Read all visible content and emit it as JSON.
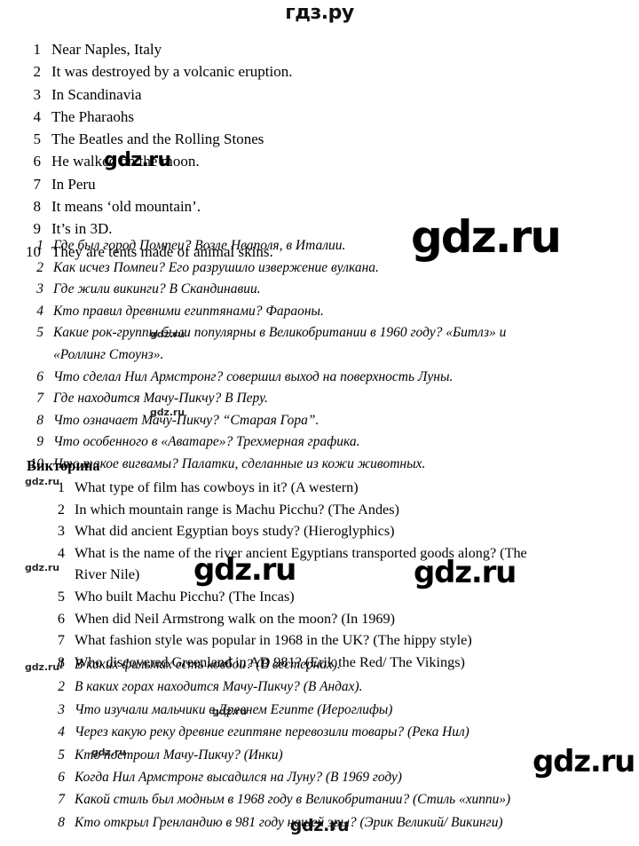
{
  "site": {
    "mark_top": "гдз.ру",
    "mark_bottom": "gdz.ru",
    "watermark_text": "gdz.ru"
  },
  "answers_en": {
    "items": [
      {
        "num": "1",
        "text": "Near Naples, Italy"
      },
      {
        "num": "2",
        "text": "It was destroyed by a volcanic eruption."
      },
      {
        "num": "3",
        "text": "In Scandinavia"
      },
      {
        "num": "4",
        "text": "The Pharaohs"
      },
      {
        "num": "5",
        "text": "The Beatles and the Rolling Stones"
      },
      {
        "num": "6",
        "text": "He walked on the moon."
      },
      {
        "num": "7",
        "text": "In Peru"
      },
      {
        "num": "8",
        "text": "It means ‘old mountain’."
      },
      {
        "num": "9",
        "text": "It’s in 3D."
      },
      {
        "num": "10",
        "text": "They are tents made of animal skins."
      }
    ]
  },
  "answers_ru": {
    "items": [
      {
        "num": "1",
        "text": "Где был город Помпеи? Возле Неаполя, в Италии."
      },
      {
        "num": "2",
        "text": "Как исчез Помпеи? Его разрушило извержение вулкана."
      },
      {
        "num": "3",
        "text": "Где жили викинги? В Скандинавии."
      },
      {
        "num": "4",
        "text": "Кто правил древними египтянами? Фараоны."
      },
      {
        "num": "5",
        "text": "Какие рок-группы были популярны в Великобритании в 1960 году? «Битлз» и",
        "text2": "«Роллинг Стоунз»."
      },
      {
        "num": "6",
        "text": "Что сделал Нил Армстронг? совершил выход на поверхность Луны."
      },
      {
        "num": "7",
        "text": "Где находится Мачу-Пикчу? В Перу."
      },
      {
        "num": "8",
        "text": "Что означает Мачу-Пикчу? “Старая Гора”."
      },
      {
        "num": "9",
        "text": "Что особенного в «Аватаре»? Трехмерная графика."
      },
      {
        "num": "10",
        "text": "Что такое вигвамы? Палатки, сделанные из кожи животных."
      }
    ]
  },
  "quiz": {
    "heading": "Викторина",
    "items_en": [
      {
        "num": "1",
        "text": "What type of film has cowboys in it? (A western)"
      },
      {
        "num": "2",
        "text": "In which mountain range is Machu Picchu? (The Andes)"
      },
      {
        "num": "3",
        "text": "What did ancient Egyptian boys study? (Hieroglyphics)"
      },
      {
        "num": "4",
        "text": "What is the name of the river ancient Egyptians transported goods along? (The",
        "text2": "River Nile)"
      },
      {
        "num": "5",
        "text": "Who built Machu Picchu? (The Incas)"
      },
      {
        "num": "6",
        "text": "When did Neil Armstrong walk on the moon? (In 1969)"
      },
      {
        "num": "7",
        "text": "What fashion style was popular in 1968 in the UK? (The hippy style)"
      },
      {
        "num": "8",
        "text": "Who discovered Greenland in AD 981? (Erik the Red/ The Vikings)"
      }
    ],
    "items_ru": [
      {
        "num": "1",
        "text": "В каких фильмах есть ковбои? (В вестернах)."
      },
      {
        "num": "2",
        "text": "В каких горах находится Мачу-Пикчу? (В Андах)."
      },
      {
        "num": "3",
        "text": "Что изучали мальчики в Древнем Египте (Иероглифы)"
      },
      {
        "num": "4",
        "text": "Через  какую реку древние египтяне перевозили товары? (Река Нил)"
      },
      {
        "num": "5",
        "text": "Кто построил Мачу-Пикчу? (Инки)"
      },
      {
        "num": "6",
        "text": "Когда Нил Армстронг высадился  на Луну? (В 1969 году)"
      },
      {
        "num": "7",
        "text": "Какой стиль был модным в 1968 году в Великобритании? (Стиль «хиппи»)"
      },
      {
        "num": "8",
        "text": "Кто открыл Гренландию в 981 году нашей эры? (Эрик Великий/ Викинги)"
      }
    ]
  }
}
